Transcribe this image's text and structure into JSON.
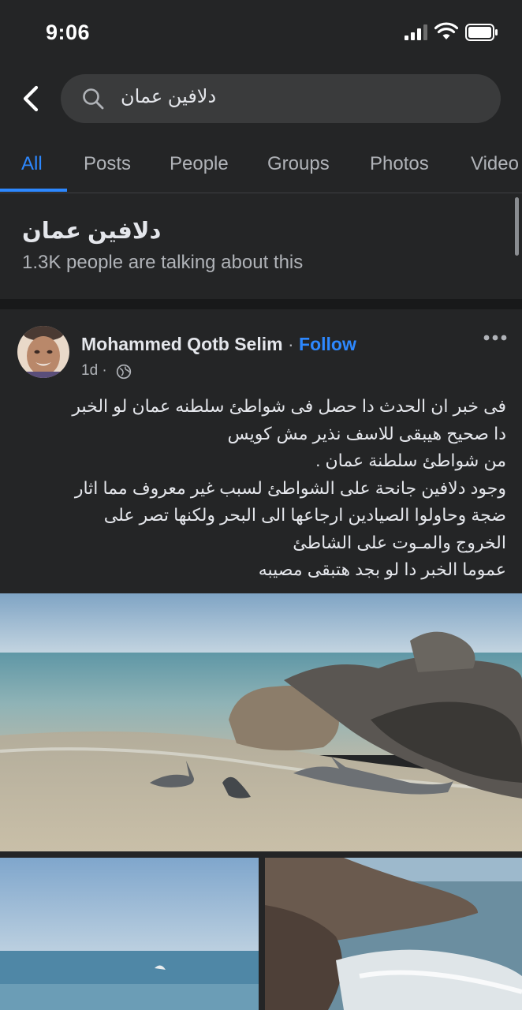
{
  "status_bar": {
    "time": "9:06"
  },
  "search": {
    "query": "دلافين عمان"
  },
  "tabs": [
    {
      "label": "All",
      "active": true
    },
    {
      "label": "Posts",
      "active": false
    },
    {
      "label": "People",
      "active": false
    },
    {
      "label": "Groups",
      "active": false
    },
    {
      "label": "Photos",
      "active": false
    },
    {
      "label": "Video",
      "active": false
    }
  ],
  "topic": {
    "title": "دلافين عمان",
    "subtitle": "1.3K people are talking about this"
  },
  "post": {
    "author": "Mohammed Qotb Selim",
    "separator": "·",
    "follow_label": "Follow",
    "time": "1d",
    "privacy_icon": "globe-icon",
    "text_lines": [
      "فى خبر ان الحدث  دا حصل فى شواطئ سلطنه عمان  لو الخبر",
      "دا صحيح هيبقى للاسف نذير مش كويس",
      "من شواطئ سلطنة عمان .",
      "وجود دلافين جانحة على الشواطئ لسبب غير معروف مما اثار",
      "ضجة وحاولوا الصيادين ارجاعها الى البحر ولكنها تصر على",
      "الخروج والمـوت على الشاطئ",
      "عموما الخبر دا لو بجد هتبقى مصيبه"
    ]
  },
  "colors": {
    "background": "#242526",
    "accent": "#2d88ff",
    "search_bg": "#3a3b3c",
    "text_primary": "#e4e6eb",
    "text_secondary": "#b0b3b8"
  }
}
